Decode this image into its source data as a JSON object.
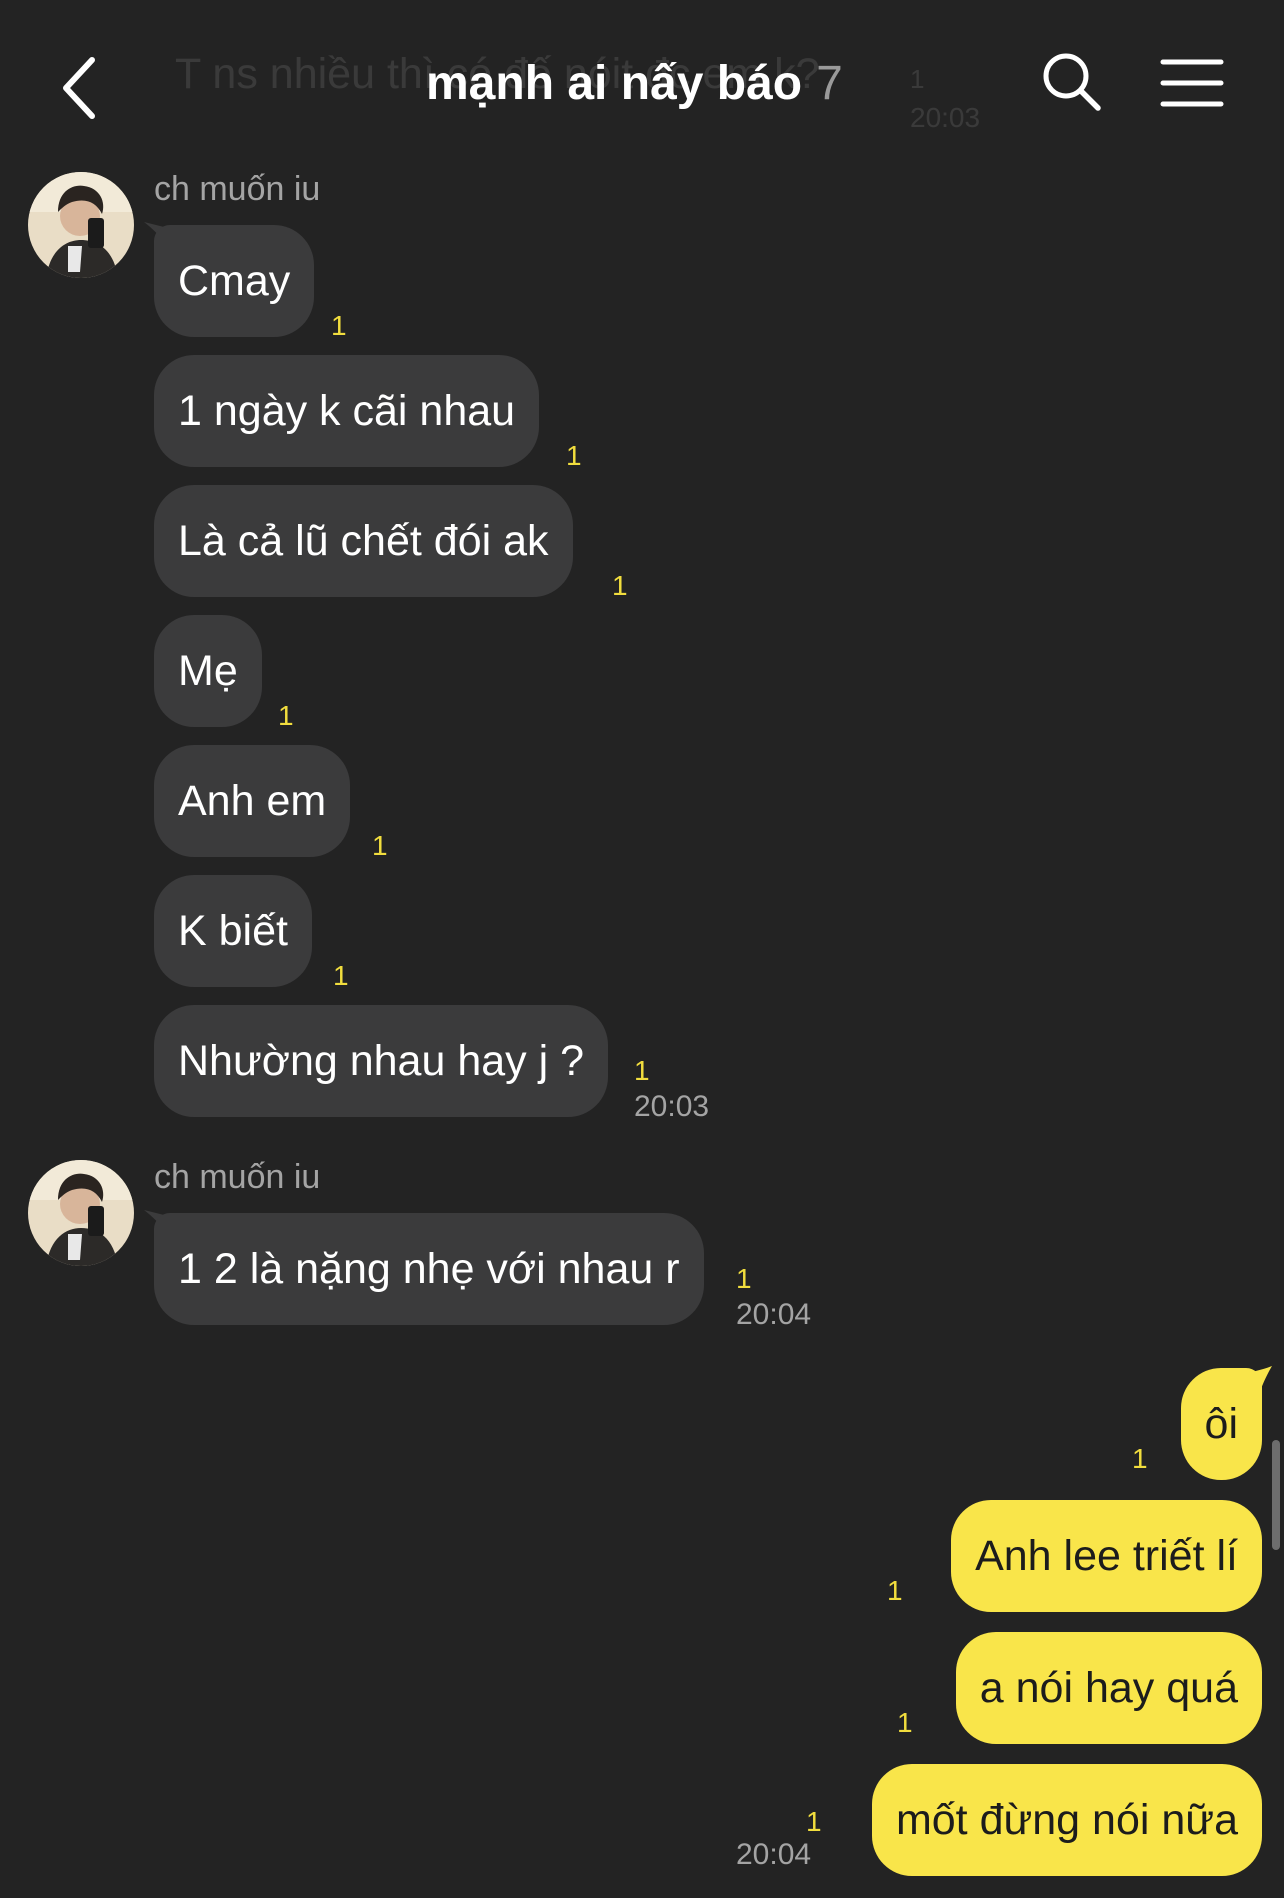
{
  "header": {
    "title": "mạnh ai nấy báo",
    "member_count": "7",
    "ghost_text": "T ns nhiều thì có đế nóit đc em k?",
    "ghost_unread": "1",
    "ghost_time": "20:03"
  },
  "groups": [
    {
      "sender": "ch muốn iu",
      "messages": [
        {
          "text": "Cmay",
          "unread": "1"
        },
        {
          "text": "1 ngày k cãi nhau",
          "unread": "1"
        },
        {
          "text": "Là cả lũ chết đói ak",
          "unread": "1"
        },
        {
          "text": "Mẹ",
          "unread": "1"
        },
        {
          "text": "Anh em",
          "unread": "1"
        },
        {
          "text": "K biết",
          "unread": "1"
        },
        {
          "text": "Nhường nhau hay j ?",
          "unread": "1",
          "time": "20:03"
        }
      ]
    },
    {
      "sender": "ch muốn iu",
      "messages": [
        {
          "text": "1 2 là nặng nhẹ với nhau r",
          "unread": "1",
          "time": "20:04"
        }
      ]
    }
  ],
  "outgoing": [
    {
      "text": "ôi",
      "unread": "1"
    },
    {
      "text": "Anh lee triết lí",
      "unread": "1"
    },
    {
      "text": "a nói hay quá",
      "unread": "1"
    },
    {
      "text": "mốt đừng nói nữa",
      "unread": "1",
      "time": "20:04"
    }
  ],
  "icons": {
    "back": "chevron-left-icon",
    "search": "search-icon",
    "menu": "hamburger-menu-icon"
  },
  "colors": {
    "background": "#232323",
    "incoming_bubble": "#3b3b3c",
    "outgoing_bubble": "#f9e54a",
    "unread_count": "#f1dd3e",
    "secondary_text": "#a4a4a4"
  }
}
